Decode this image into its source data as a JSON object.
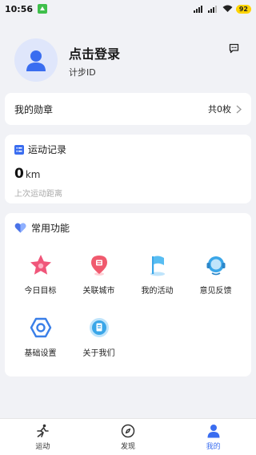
{
  "status_bar": {
    "time": "10:56",
    "battery": "92"
  },
  "profile": {
    "title": "点击登录",
    "subtitle": "计步ID"
  },
  "medals": {
    "title": "我的勋章",
    "count": "共0枚"
  },
  "sport_record": {
    "title": "运动记录",
    "distance_value": "0",
    "distance_unit": "km",
    "distance_label": "上次运动距离"
  },
  "functions": {
    "title": "常用功能",
    "items": [
      {
        "label": "今日目标",
        "icon": "star-target-icon"
      },
      {
        "label": "关联城市",
        "icon": "city-pin-icon"
      },
      {
        "label": "我的活动",
        "icon": "flag-icon"
      },
      {
        "label": "意见反馈",
        "icon": "headset-icon"
      },
      {
        "label": "基础设置",
        "icon": "hexagon-settings-icon"
      },
      {
        "label": "关于我们",
        "icon": "info-doc-icon"
      }
    ]
  },
  "bottom_nav": {
    "items": [
      {
        "label": "运动",
        "icon": "running-icon"
      },
      {
        "label": "发现",
        "icon": "compass-icon"
      },
      {
        "label": "我的",
        "icon": "person-icon",
        "active": true
      }
    ]
  },
  "colors": {
    "accent": "#3a6df0",
    "background": "#f1f2f6"
  }
}
